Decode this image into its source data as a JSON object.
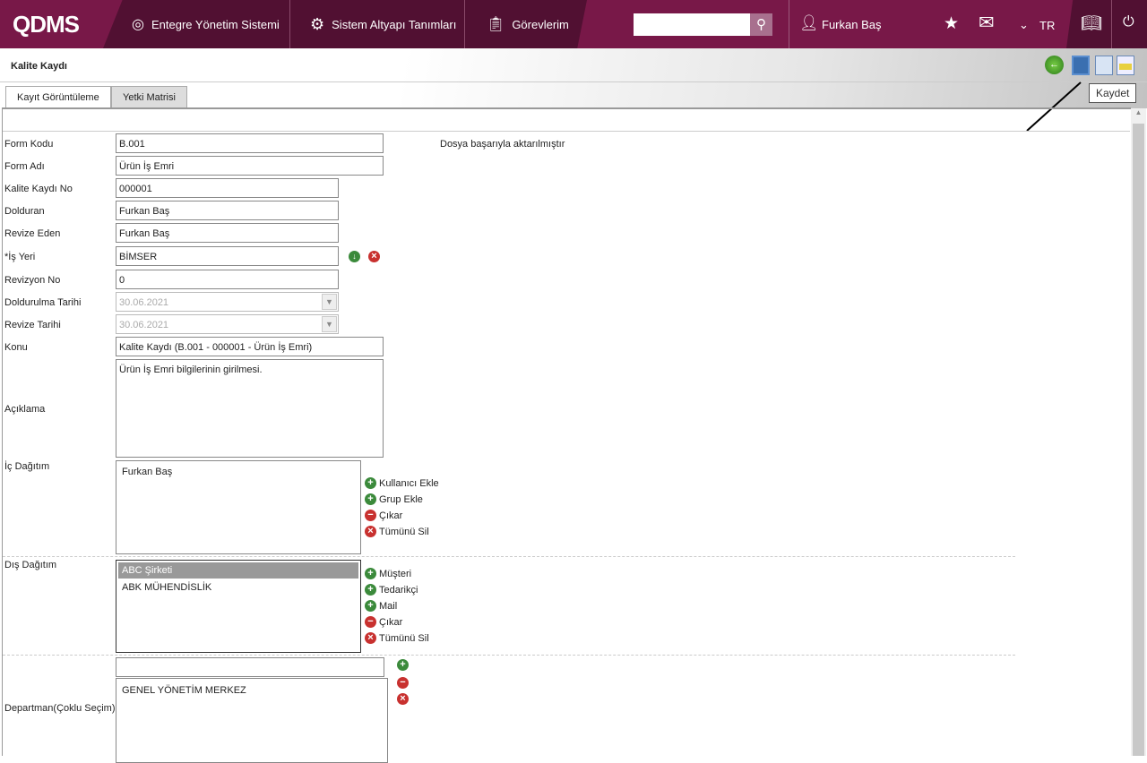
{
  "header": {
    "logo": "QDMS",
    "nav": [
      "Entegre Yönetim Sistemi",
      "Sistem Altyapı Tanımları",
      "Görevlerim"
    ],
    "user": "Furkan Baş",
    "lang": "TR"
  },
  "page": {
    "title": "Kalite Kaydı",
    "tabs": [
      "Kayıt Görüntüleme",
      "Yetki Matrisi"
    ],
    "tooltip": "Kaydet",
    "message": "Dosya başarıyla aktarılmıştır"
  },
  "form": {
    "form_kodu": {
      "label": "Form Kodu",
      "value": "B.001"
    },
    "form_adi": {
      "label": "Form Adı",
      "value": "Ürün İş Emri"
    },
    "kayit_no": {
      "label": "Kalite Kaydı No",
      "value": "000001"
    },
    "dolduran": {
      "label": "Dolduran",
      "value": "Furkan Baş"
    },
    "revize_eden": {
      "label": "Revize Eden",
      "value": "Furkan Baş"
    },
    "is_yeri": {
      "label": "*İş Yeri",
      "value": "BİMSER"
    },
    "revizyon_no": {
      "label": "Revizyon No",
      "value": "0"
    },
    "doldurulma_tarihi": {
      "label": "Doldurulma Tarihi",
      "value": "30.06.2021"
    },
    "revize_tarihi": {
      "label": "Revize Tarihi",
      "value": "30.06.2021"
    },
    "konu": {
      "label": "Konu",
      "value": "Kalite Kaydı (B.001 - 000001 - Ürün İş Emri)"
    },
    "aciklama": {
      "label": "Açıklama",
      "value": "Ürün İş Emri bilgilerinin girilmesi."
    },
    "ic_dagitim": {
      "label": "İç Dağıtım",
      "items": [
        "Furkan Baş"
      ],
      "actions": [
        "Kullanıcı Ekle",
        "Grup Ekle",
        "Çıkar",
        "Tümünü Sil"
      ]
    },
    "dis_dagitim": {
      "label": "Dış Dağıtım",
      "items": [
        "ABC Şirketi",
        "ABK MÜHENDİSLİK"
      ],
      "actions": [
        "Müşteri",
        "Tedarikçi",
        "Mail",
        "Çıkar",
        "Tümünü Sil"
      ]
    },
    "departman": {
      "label": "Departman(Çoklu Seçim)",
      "value": "",
      "items": [
        "GENEL YÖNETİM MERKEZ"
      ]
    }
  }
}
